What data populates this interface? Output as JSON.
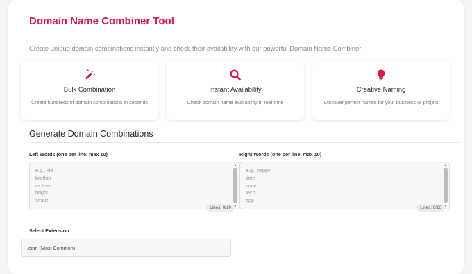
{
  "colors": {
    "accent": "#d6194a"
  },
  "header": {
    "title": "Domain Name Combiner Tool",
    "intro": "Create unique domain combinations instantly and check their availability with our powerful Domain Name Combiner."
  },
  "features": [
    {
      "icon": "magic-wand-icon",
      "title": "Bulk Combination",
      "description": "Create hundreds of domain combinations in seconds"
    },
    {
      "icon": "search-icon",
      "title": "Instant Availability",
      "description": "Check domain name availability in real-time"
    },
    {
      "icon": "lightbulb-icon",
      "title": "Creative Naming",
      "description": "Discover perfect names for your business or project"
    }
  ],
  "generator": {
    "heading": "Generate Domain Combinations",
    "left": {
      "label": "Left Words (one per line, max 10)",
      "placeholder_lines": [
        "e.g., kid",
        "brother",
        "mother",
        "bright",
        "smart"
      ],
      "counter": "Lines: 0/10"
    },
    "right": {
      "label": "Right Words (one per line, max 10)",
      "placeholder_lines": [
        "e.g., happy",
        "time",
        "zone",
        "tech",
        "app"
      ],
      "counter": "Lines: 0/10"
    },
    "extension": {
      "label": "Select Extension",
      "selected": ".com (Most Common)"
    }
  }
}
